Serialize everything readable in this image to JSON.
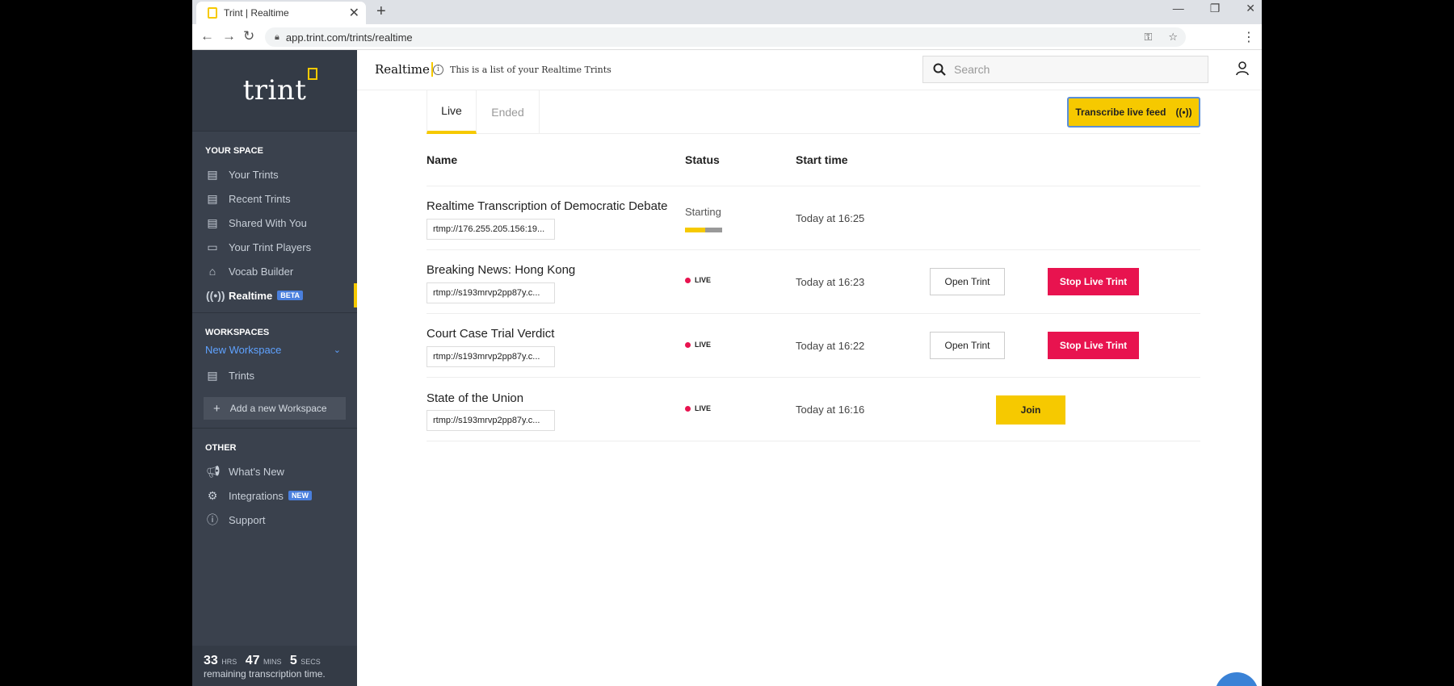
{
  "browser": {
    "tab_title": "Trint | Realtime",
    "url": "app.trint.com/trints/realtime",
    "new_tab": "+",
    "close_tab": "✕"
  },
  "sidebar": {
    "logo": "trint",
    "your_space_title": "YOUR SPACE",
    "your_space_items": [
      {
        "label": "Your Trints",
        "icon": "document-icon"
      },
      {
        "label": "Recent Trints",
        "icon": "recent-document-icon"
      },
      {
        "label": "Shared With You",
        "icon": "shared-document-icon"
      },
      {
        "label": "Your Trint Players",
        "icon": "player-icon"
      },
      {
        "label": "Vocab Builder",
        "icon": "graduation-cap-icon"
      },
      {
        "label": "Realtime",
        "icon": "broadcast-icon",
        "badge": "BETA",
        "active": true
      }
    ],
    "workspaces_title": "WORKSPACES",
    "workspace_name": "New Workspace",
    "workspace_items": [
      {
        "label": "Trints",
        "icon": "document-icon"
      }
    ],
    "add_workspace": "Add a new Workspace",
    "other_title": "OTHER",
    "other_items": [
      {
        "label": "What's New",
        "icon": "megaphone-icon"
      },
      {
        "label": "Integrations",
        "icon": "integrations-icon",
        "badge": "NEW"
      },
      {
        "label": "Support",
        "icon": "help-icon"
      }
    ],
    "time": {
      "hrs": "33",
      "hrs_unit": "HRS",
      "mins": "47",
      "mins_unit": "MINS",
      "secs": "5",
      "secs_unit": "SECS",
      "remaining": "remaining transcription time."
    }
  },
  "header": {
    "title": "Realtime",
    "info": "This is a list of your Realtime Trints",
    "search_placeholder": "Search"
  },
  "main": {
    "tabs": [
      {
        "label": "Live",
        "active": true
      },
      {
        "label": "Ended",
        "active": false
      }
    ],
    "transcribe_button": "Transcribe live feed",
    "columns": {
      "name": "Name",
      "status": "Status",
      "start_time": "Start time"
    },
    "rows": [
      {
        "name": "Realtime Transcription of Democratic Debate",
        "url": "rtmp://176.255.205.156:19...",
        "status": "Starting",
        "progress": 0.55,
        "time": "Today at 16:25"
      },
      {
        "name": "Breaking News: Hong Kong",
        "url": "rtmp://s193mrvp2pp87y.c...",
        "status": "LIVE",
        "time": "Today at 16:23",
        "open": "Open Trint",
        "stop": "Stop Live Trint"
      },
      {
        "name": "Court Case Trial Verdict",
        "url": "rtmp://s193mrvp2pp87y.c...",
        "status": "LIVE",
        "time": "Today at 16:22",
        "open": "Open Trint",
        "stop": "Stop Live Trint"
      },
      {
        "name": "State of the Union",
        "url": "rtmp://s193mrvp2pp87y.c...",
        "status": "LIVE",
        "time": "Today at 16:16",
        "join": "Join"
      }
    ]
  },
  "colors": {
    "accent": "#f6c900",
    "danger": "#e8134f",
    "sidebar_bg": "#3a414d",
    "link_blue": "#5fa2ff"
  }
}
